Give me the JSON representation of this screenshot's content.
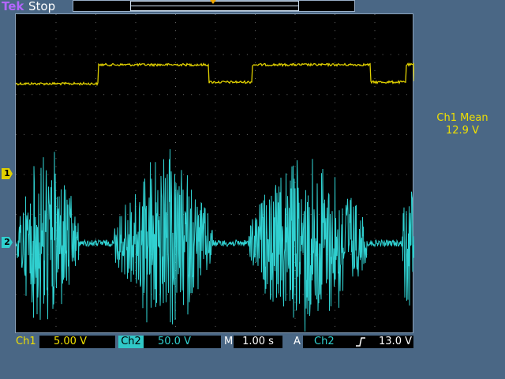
{
  "header": {
    "brand": "Tek",
    "run_state": "Stop"
  },
  "channels": {
    "ch1": {
      "marker": "1",
      "label": "Ch1",
      "scale": "5.00 V",
      "color": "#e0d000"
    },
    "ch2": {
      "marker": "2",
      "label": "Ch2",
      "scale": "50.0 V",
      "color": "#30d0d0"
    }
  },
  "measurement": {
    "label": "Ch1 Mean",
    "value": "12.9 V"
  },
  "timebase": {
    "label": "M",
    "scale": "1.00 s"
  },
  "trigger": {
    "label": "A",
    "source": "Ch2",
    "slope_icon": "rising-edge-icon",
    "level": "13.0 V",
    "color": "#f0a800"
  }
}
